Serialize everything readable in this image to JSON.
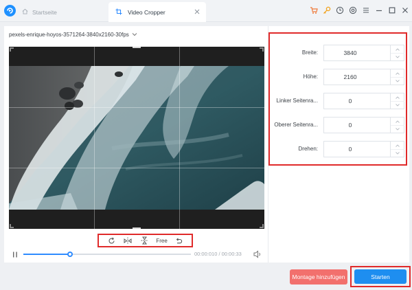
{
  "titlebar": {
    "tabs": [
      {
        "label": "Startseite",
        "icon": "home-icon",
        "active": false
      },
      {
        "label": "Video Cropper",
        "icon": "crop-icon",
        "active": true
      }
    ],
    "icons": [
      "cart-icon",
      "key-icon",
      "clock-icon",
      "settings-icon",
      "menu-icon",
      "minimize-icon",
      "maximize-icon",
      "close-icon"
    ]
  },
  "file": {
    "name": "pexels-enrique-hoyos-3571264-3840x2160-30fps"
  },
  "tools": {
    "free_label": "Free"
  },
  "playback": {
    "time": "00:00:010 / 00:00:33",
    "progress": 0.28
  },
  "fields": [
    {
      "label": "Breite:",
      "value": "3840"
    },
    {
      "label": "Höhe:",
      "value": "2160"
    },
    {
      "label": "Linker Seitenra...",
      "value": "0"
    },
    {
      "label": "Oberer Seitenra...",
      "value": "0"
    },
    {
      "label": "Drehen:",
      "value": "0"
    }
  ],
  "buttons": {
    "add_montage": "Montage hinzufügen",
    "start": "Starten"
  },
  "colors": {
    "accent": "#1e8ef0",
    "highlight": "#e02a2a",
    "add_button": "#f2706d"
  }
}
